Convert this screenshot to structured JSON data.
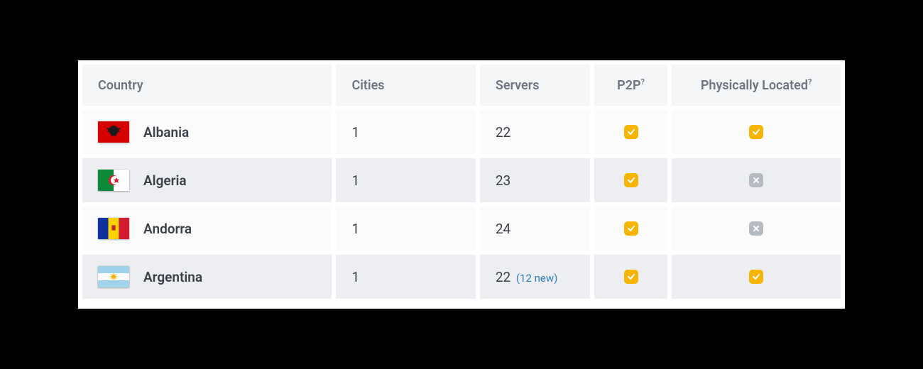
{
  "headers": {
    "country": "Country",
    "cities": "Cities",
    "servers": "Servers",
    "p2p": "P2P",
    "p2p_sup": "?",
    "physical": "Physically Located",
    "physical_sup": "?"
  },
  "status_colors": {
    "yes": "#f7b500",
    "no": "#b6bac1"
  },
  "rows": [
    {
      "country": "Albania",
      "flag": "albania",
      "cities": "1",
      "servers": "22",
      "servers_note": "",
      "p2p": true,
      "physical": true
    },
    {
      "country": "Algeria",
      "flag": "algeria",
      "cities": "1",
      "servers": "23",
      "servers_note": "",
      "p2p": true,
      "physical": false
    },
    {
      "country": "Andorra",
      "flag": "andorra",
      "cities": "1",
      "servers": "24",
      "servers_note": "",
      "p2p": true,
      "physical": false
    },
    {
      "country": "Argentina",
      "flag": "argentina",
      "cities": "1",
      "servers": "22",
      "servers_note": "(12 new)",
      "p2p": true,
      "physical": true
    }
  ]
}
